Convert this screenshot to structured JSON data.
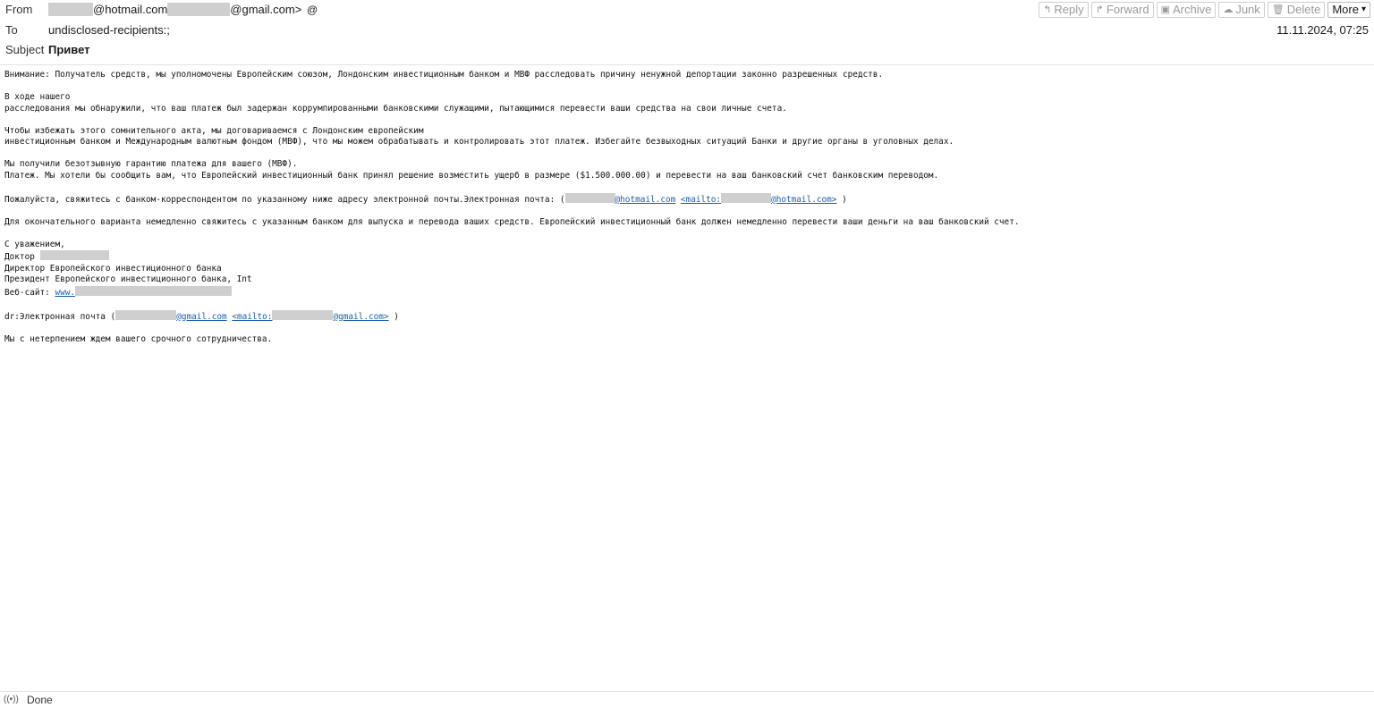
{
  "header": {
    "from_label": "From",
    "from_part1": "@hotmail.com",
    "from_part2": "@gmail.com>",
    "to_label": "To",
    "to_value": "undisclosed-recipients:;",
    "subject_label": "Subject",
    "subject_value": "Привет",
    "date": "11.11.2024, 07:25"
  },
  "toolbar": {
    "reply": "Reply",
    "forward": "Forward",
    "archive": "Archive",
    "junk": "Junk",
    "delete": "Delete",
    "more": "More"
  },
  "body": {
    "p1": "Внимание: Получатель средств, мы уполномочены Европейским союзом, Лондонским инвестиционным банком и МВФ расследовать причину ненужной депортации законно разрешенных средств.",
    "p2a": "В ходе нашего",
    "p2b": "расследования мы обнаружили, что ваш платеж был задержан коррумпированными банковскими служащими, пытающимися перевести ваши средства на свои личные счета.",
    "p3a": "Чтобы избежать этого сомнительного акта, мы договариваемся с Лондонским европейским",
    "p3b": "инвестиционным банком и Международным валютным фондом (МВФ), что мы можем обрабатывать и контролировать этот платеж. Избегайте безвыходных ситуаций Банки и другие органы в уголовных делах.",
    "p4a": "Мы получили безотзывную гарантию платежа для вашего (МВФ).",
    "p4b": "Платеж. Мы хотели бы сообщить вам, что Европейский инвестиционный банк принял решение возместить ущерб в размере ($1.500.000.00) и перевести на ваш банковский счет банковским переводом.",
    "p5_text": "Пожалуйста, свяжитесь с банком-корреспондентом по указанному ниже адресу электронной почты.Электронная почта: (",
    "p5_link1": "@hotmail.com",
    "p5_mailto": "<mailto:",
    "p5_link2": "@hotmail.com>",
    "p5_end": " )",
    "p6": "Для окончательного варианта немедленно свяжитесь с указанным банком для выпуска и перевода ваших средств. Европейский инвестиционный банк должен немедленно перевести ваши деньги на ваш банковский счет.",
    "sig1": "С уважением,",
    "sig2": "Доктор ",
    "sig3": "Директор Европейского инвестиционного банка",
    "sig4": "Президент Европейского инвестиционного банка, Int",
    "sig5": "Веб-сайт: ",
    "sig5_link": "www.",
    "p7_text": "dr:Электронная почта (",
    "p7_link1": "@gmail.com",
    "p7_mailto": "<mailto:",
    "p7_link2": "@gmail.com>",
    "p7_end": " )",
    "p8": "Мы с нетерпением ждем вашего срочного сотрудничества."
  },
  "status": {
    "text": "Done",
    "icon": "wifi-signal-icon"
  }
}
